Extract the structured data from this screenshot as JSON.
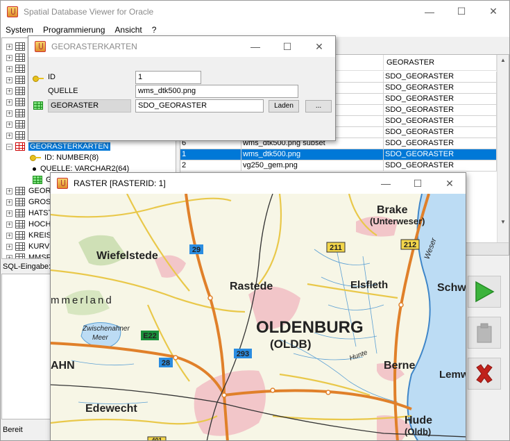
{
  "main_window": {
    "title": "Spatial Database Viewer for Oracle",
    "menu": [
      "System",
      "Programmierung",
      "Ansicht",
      "?"
    ],
    "minimize_glyph": "—",
    "maximize_glyph": "☐",
    "close_glyph": "✕"
  },
  "tree": {
    "selected_node": "GEORASTERKARTEN",
    "children": [
      {
        "label": "ID: NUMBER(8)",
        "icon": "key-icon"
      },
      {
        "label": "QUELLE: VARCHAR2(64)",
        "icon": "bullet-icon"
      },
      {
        "label": "G",
        "icon": "raster-grid-icon"
      }
    ],
    "nodes_below": [
      "GEORA",
      "GROSS",
      "HATST",
      "HOCHS",
      "KREIS",
      "KURVE",
      "MMSF"
    ]
  },
  "table": {
    "header_georaster": "GEORASTER",
    "rows": [
      {
        "id": "",
        "quelle": "",
        "georaster": "SDO_GEORASTER"
      },
      {
        "id": "",
        "quelle": "",
        "georaster": "SDO_GEORASTER"
      },
      {
        "id": "",
        "quelle": "",
        "georaster": "SDO_GEORASTER"
      },
      {
        "id": "",
        "quelle": "",
        "georaster": "SDO_GEORASTER"
      },
      {
        "id": "",
        "quelle": "",
        "georaster": "SDO_GEORASTER"
      },
      {
        "id": "",
        "quelle": "",
        "georaster": "SDO_GEORASTER"
      },
      {
        "id": "6",
        "quelle": "wms_dtk500.png subset",
        "georaster": "SDO_GEORASTER"
      },
      {
        "id": "1",
        "quelle": "wms_dtk500.png",
        "georaster": "SDO_GEORASTER",
        "selected": true
      },
      {
        "id": "2",
        "quelle": "vg250_gem.png",
        "georaster": "SDO_GEORASTER"
      }
    ]
  },
  "sql": {
    "label": "SQL-Eingabe:"
  },
  "status": {
    "text": "Bereit"
  },
  "colors": {
    "selection": "#0078d7",
    "run_button": "#3bb33b",
    "cancel_button": "#c0221b"
  },
  "georaster_dialog": {
    "title": "GEORASTERKARTEN",
    "fields": {
      "id_label": "ID",
      "id_value": "1",
      "quelle_label": "QUELLE",
      "quelle_value": "wms_dtk500.png",
      "georaster_label": "GEORASTER",
      "georaster_value": "SDO_GEORASTER"
    },
    "load_button": "Laden",
    "more_button": "..."
  },
  "raster_dialog": {
    "title": "RASTER [RASTERID: 1]",
    "map_labels": {
      "wiefelstede": "Wiefelstede",
      "rastede": "Rastede",
      "oldenburg": "OLDENBURG",
      "oldb": "(OLDB)",
      "elsfleth": "Elsfleth",
      "brake": "Brake",
      "unterweser": "(Unterweser)",
      "ammerland": "mmerland",
      "zwischenahner": "Zwischenahner",
      "meer": "Meer",
      "berne": "Berne",
      "edewecht": "Edewecht",
      "hude": "Hude",
      "hude_oldb": "(Oldb)",
      "hahn": "AHN",
      "schw": "Schw",
      "lemw": "Lemw",
      "weser": "Weser",
      "hunte": "Hunte",
      "road_29": "29",
      "road_211": "211",
      "road_212": "212",
      "road_e22": "E22",
      "road_28": "28",
      "road_293": "293",
      "road_401": "401"
    }
  }
}
